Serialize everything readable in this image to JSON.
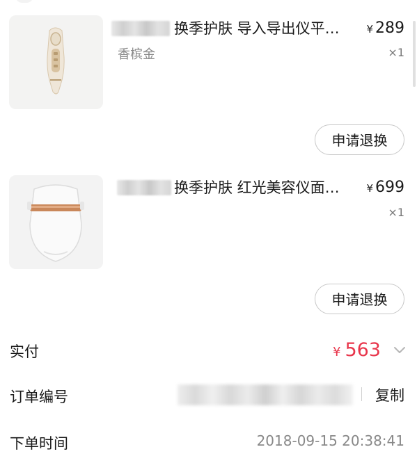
{
  "items": [
    {
      "title": "换季护肤 导入导出仪平…",
      "price_symbol": "¥",
      "price": "289",
      "variant": "香槟金",
      "qty": "×1",
      "refund_label": "申请退换",
      "image_icon": "beauty-device-wand-icon"
    },
    {
      "title": "换季护肤 红光美容仪面…",
      "price_symbol": "¥",
      "price": "699",
      "variant": "",
      "qty": "×1",
      "refund_label": "申请退换",
      "image_icon": "led-face-mask-icon"
    }
  ],
  "summary": {
    "paid_label": "实付",
    "paid_symbol": "¥",
    "paid_amount": "563",
    "paid_color": "#e8354b",
    "order_no_label": "订单编号",
    "copy_label": "复制",
    "order_time_label": "下单时间",
    "order_time": "2018-09-15 20:38:41"
  }
}
